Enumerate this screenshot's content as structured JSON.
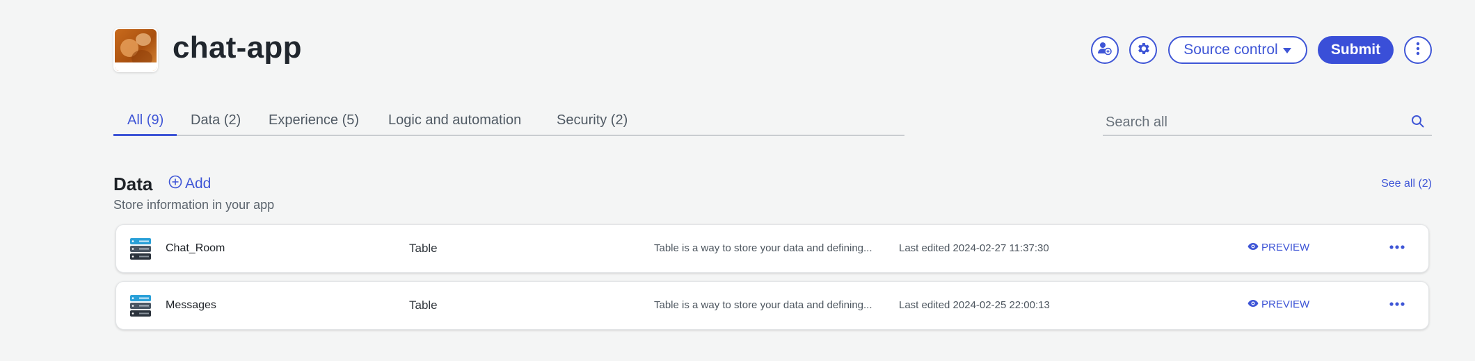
{
  "header": {
    "app_title": "chat-app",
    "source_control_label": "Source control",
    "submit_label": "Submit"
  },
  "tabs": [
    {
      "label": "All (9)",
      "active": true
    },
    {
      "label": "Data (2)",
      "active": false
    },
    {
      "label": "Experience (5)",
      "active": false
    },
    {
      "label": "Logic and automation",
      "active": false
    },
    {
      "label": "Security (2)",
      "active": false
    }
  ],
  "search": {
    "placeholder": "Search all",
    "value": ""
  },
  "data_section": {
    "title": "Data",
    "add_label": "Add",
    "description": "Store information in your app",
    "see_all_label": "See all (2)",
    "rows": [
      {
        "name": "Chat_Room",
        "type": "Table",
        "description": "Table is a way to store your data and defining...",
        "edited": "Last edited 2024-02-27 11:37:30",
        "preview_label": "PREVIEW"
      },
      {
        "name": "Messages",
        "type": "Table",
        "description": "Table is a way to store your data and defining...",
        "edited": "Last edited 2024-02-25 22:00:13",
        "preview_label": "PREVIEW"
      }
    ]
  },
  "colors": {
    "accent": "#3e55d6",
    "background": "#f4f5f5"
  },
  "icons": [
    "user-share-icon",
    "gear-icon",
    "caret-down-icon",
    "vertical-dots-icon",
    "search-icon",
    "plus-circle-icon",
    "database-icon",
    "eye-icon",
    "horizontal-dots-icon"
  ]
}
